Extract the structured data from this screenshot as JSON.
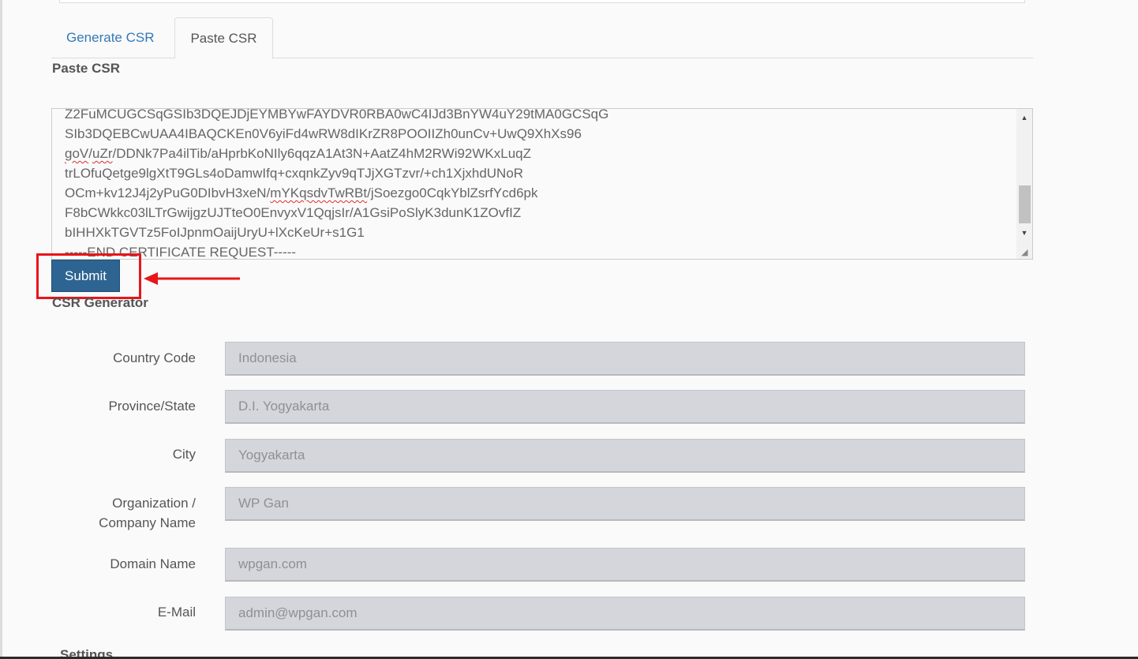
{
  "tabs": [
    {
      "label": "Generate CSR",
      "active": false
    },
    {
      "label": "Paste CSR",
      "active": true
    }
  ],
  "paste_section": {
    "title": "Paste CSR",
    "csr_lines": [
      "Z2FuMCUGCSqGSIb3DQEJDjEYMBYwFAYDVR0RBA0wC4IJd3BnYW4uY29tMA0GCSqG",
      "SIb3DQEBCwUAA4IBAQCKEn0V6yiFd4wRW8dIKrZR8POOIIZh0unCv+UwQ9XhXs96",
      "goV/uZr/DDNk7Pa4ilTib/aHprbKoNIly6qqzA1At3N+AatZ4hM2RWi92WKxLuqZ",
      "trLOfuQetge9lgXtT9GLs4oDamwIfq+cxqnkZyv9qTJjXGTzvr/+ch1XjxhdUNoR",
      "OCm+kv12J4j2yPuG0DIbvH3xeN/mYKqsdvTwRBt/jSoezgo0CqkYblZsrfYcd6pk",
      "F8bCWkkc03lLTrGwijgzUJTteO0EnvyxV1QqjsIr/A1GsiPoSlyK3dunK1ZOvfIZ",
      "bIHHXkTGVTz5FoIJpnmOaijUryU+lXcKeUr+s1G1",
      "-----END CERTIFICATE REQUEST-----"
    ],
    "submit_label": "Submit"
  },
  "generator": {
    "title": "CSR Generator",
    "fields": [
      {
        "label": "Country Code",
        "value": "Indonesia"
      },
      {
        "label": "Province/State",
        "value": "D.I. Yogyakarta"
      },
      {
        "label": "City",
        "value": "Yogyakarta"
      },
      {
        "label": "Organization / Company Name",
        "value": "WP Gan"
      },
      {
        "label": "Domain Name",
        "value": "wpgan.com"
      },
      {
        "label": "E-Mail",
        "value": "admin@wpgan.com"
      }
    ]
  },
  "settings": {
    "title": "Settings"
  },
  "colors": {
    "accent": "#2e6491",
    "highlight": "#e8151b",
    "link": "#337ab7"
  }
}
